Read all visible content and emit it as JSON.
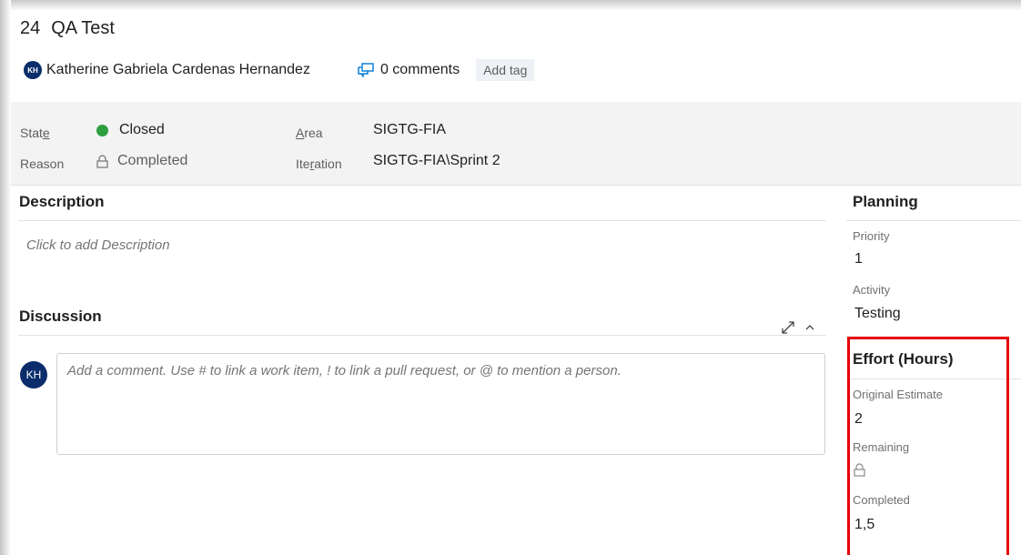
{
  "work_item": {
    "id": "24",
    "title": "QA Test",
    "assignee": {
      "initials": "KH",
      "name": "Katherine Gabriela Cardenas Hernandez"
    },
    "comments_label": "0 comments",
    "add_tag_label": "Add tag"
  },
  "fields": {
    "state": {
      "label_pre": "Stat",
      "label_u": "e",
      "value": "Closed",
      "color": "#2e9e3f"
    },
    "reason": {
      "label": "Reason",
      "value": "Completed"
    },
    "area": {
      "label_u": "A",
      "label_post": "rea",
      "value": "SIGTG-FIA"
    },
    "iteration": {
      "label_pre": "Ite",
      "label_u": "r",
      "label_post": "ation",
      "value": "SIGTG-FIA\\Sprint 2"
    }
  },
  "description": {
    "heading": "Description",
    "placeholder": "Click to add Description"
  },
  "discussion": {
    "heading": "Discussion",
    "avatar_initials": "KH",
    "comment_placeholder": "Add a comment. Use # to link a work item, ! to link a pull request, or @ to mention a person."
  },
  "planning": {
    "heading": "Planning",
    "priority_label": "Priority",
    "priority_value": "1",
    "activity_label": "Activity",
    "activity_value": "Testing"
  },
  "effort": {
    "heading": "Effort (Hours)",
    "original_estimate_label": "Original Estimate",
    "original_estimate_value": "2",
    "remaining_label": "Remaining",
    "completed_label": "Completed",
    "completed_value": "1,5"
  },
  "icons": {
    "comments": "comments-icon",
    "lock": "lock-icon",
    "expand": "expand-icon",
    "collapse": "chevron-up-icon"
  },
  "colors": {
    "avatar": "#0b2d6b",
    "highlight": "#e60000",
    "comments_icon": "#0078d4"
  }
}
